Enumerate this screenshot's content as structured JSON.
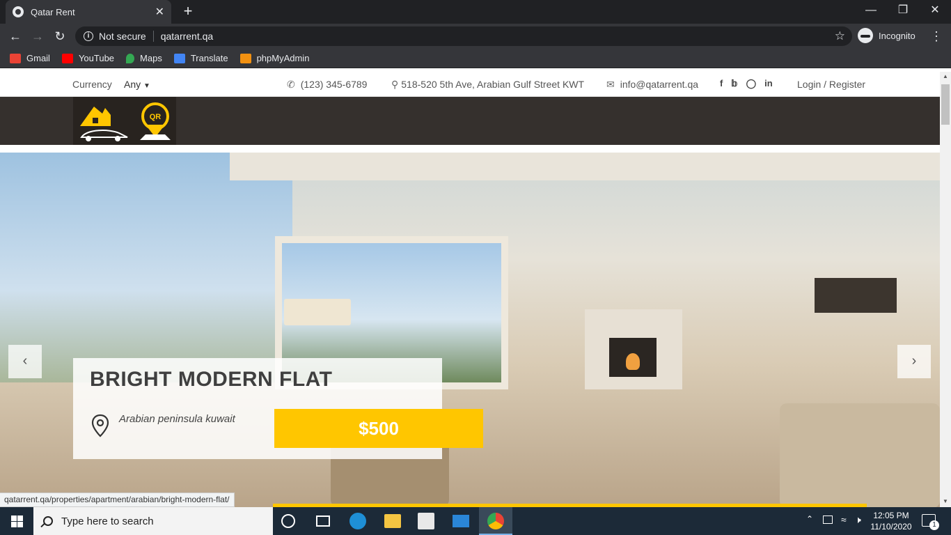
{
  "browser": {
    "tab_title": "Qatar Rent",
    "tab_close": "✕",
    "new_tab": "+",
    "security_label": "Not secure",
    "url": "qatarrent.qa",
    "profile_label": "Incognito",
    "bookmarks": [
      {
        "label": "Gmail",
        "color": "#ea4335"
      },
      {
        "label": "YouTube",
        "color": "#ff0000"
      },
      {
        "label": "Maps",
        "color": "#34a853"
      },
      {
        "label": "Translate",
        "color": "#4285f4"
      },
      {
        "label": "phpMyAdmin",
        "color": "#f29111"
      }
    ]
  },
  "site": {
    "topbar": {
      "currency_label": "Currency",
      "currency_value": "Any",
      "phone": "(123) 345-6789",
      "address": "518-520 5th Ave, Arabian Gulf Street KWT",
      "email": "info@qatarrent.qa",
      "social_icons": [
        "facebook-icon",
        "twitter-icon",
        "instagram-icon",
        "linkedin-icon"
      ],
      "auth_link": "Login / Register"
    },
    "logo_text": "QR",
    "slide": {
      "title": "BRIGHT MODERN FLAT",
      "location": "Arabian peninsula kuwait",
      "price": "$500"
    },
    "accent_color": "#ffc600",
    "status_url": "qatarrent.qa/properties/apartment/arabian/bright-modern-flat/"
  },
  "taskbar": {
    "search_placeholder": "Type here to search",
    "time": "12:05 PM",
    "date": "11/10/2020",
    "notifications": "1"
  }
}
